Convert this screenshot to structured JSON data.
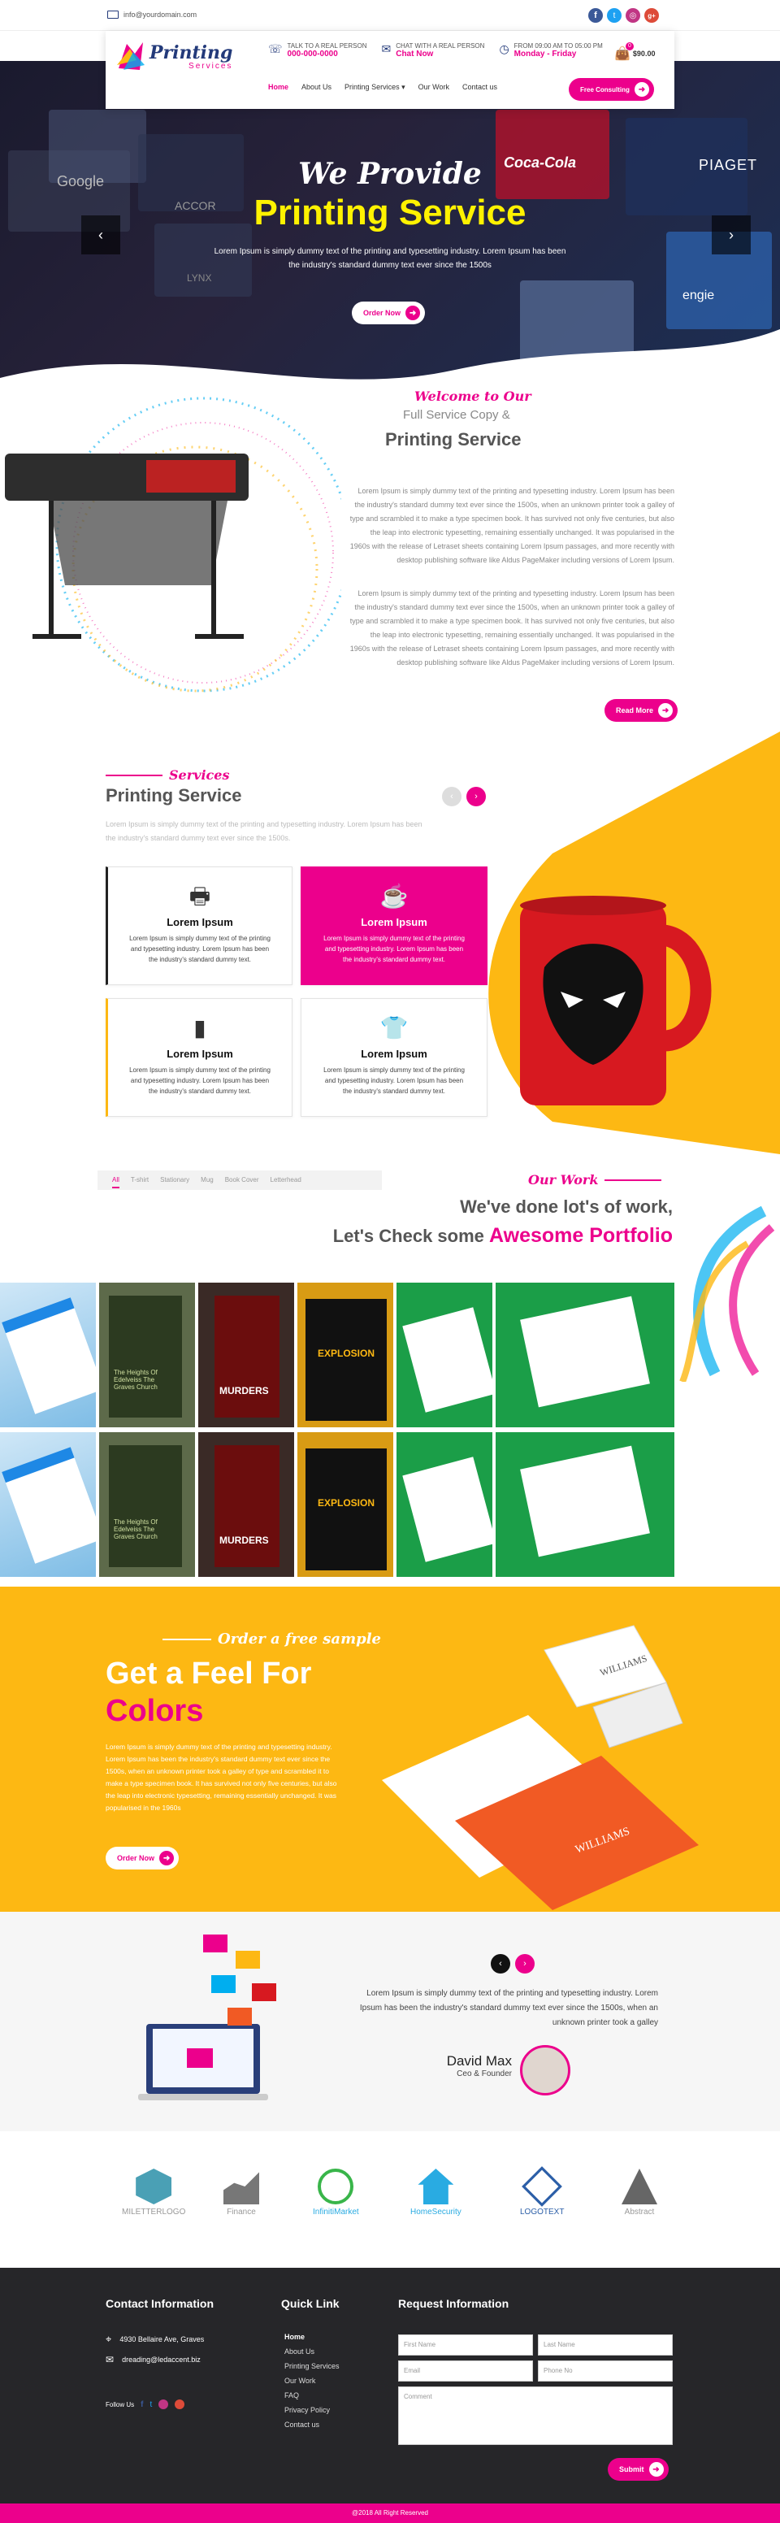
{
  "colors": {
    "pink": "#ec008c",
    "yellow": "#fdb813",
    "dark": "#262629",
    "navy": "#233a7a"
  },
  "topbar": {
    "email": "info@yourdomain.com",
    "socials": [
      "facebook-icon",
      "twitter-icon",
      "instagram-icon",
      "google-plus-icon"
    ]
  },
  "brand": {
    "name": "Printing",
    "sub": "Services"
  },
  "contact": [
    {
      "label": "TALK TO A REAL PERSON",
      "value": "000-000-0000"
    },
    {
      "label": "CHAT WITH A REAL PERSON",
      "value": "Chat Now"
    },
    {
      "label": "FROM 09:00 AM TO 05:00 PM",
      "value": "Monday - Friday"
    }
  ],
  "cart": {
    "price": "$90.00",
    "count": "0"
  },
  "nav": {
    "items": [
      "Home",
      "About Us",
      "Printing Services",
      "Our Work",
      "Contact us"
    ],
    "cta": "Free Consulting"
  },
  "hero": {
    "line1": "We Provide",
    "line2": "Printing Service",
    "text": "Lorem Ipsum is simply dummy text of the printing and typesetting industry. Lorem Ipsum has been the industry's standard dummy text ever since the 1500s",
    "btn": "Order Now",
    "tiles": [
      "Coca-Cola",
      "Google",
      "ACCOR",
      "PIAGET",
      "engie",
      "LYNX"
    ]
  },
  "about": {
    "script": "Welcome to Our",
    "sub": "Full Service Copy &",
    "title": "Printing Service",
    "p1": "Lorem Ipsum is simply dummy text of the printing and typesetting industry. Lorem Ipsum has been the industry's standard dummy text ever since the 1500s, when an unknown printer took a galley of type and scrambled it to make a type specimen book. It has survived not only five centuries, but also the leap into electronic typesetting, remaining essentially unchanged. It was popularised in the 1960s with the release of Letraset sheets containing Lorem Ipsum passages, and more recently with desktop publishing software like Aldus PageMaker including versions of Lorem Ipsum.",
    "p2": "Lorem Ipsum is simply dummy text of the printing and typesetting industry. Lorem Ipsum has been the industry's standard dummy text ever since the 1500s, when an unknown printer took a galley of type and scrambled it to make a type specimen book. It has survived not only five centuries, but also the leap into electronic typesetting, remaining essentially unchanged. It was popularised in the 1960s with the release of Letraset sheets containing Lorem Ipsum passages, and more recently with desktop publishing software like Aldus PageMaker including versions of Lorem Ipsum.",
    "btn": "Read More"
  },
  "services": {
    "script": "Services",
    "title": "Printing Service",
    "text": "Lorem Ipsum is simply dummy text of the printing and typesetting industry. Lorem Ipsum has been the industry's standard dummy text ever since the 1500s.",
    "cards": [
      {
        "title": "Lorem Ipsum",
        "text": "Lorem Ipsum is simply dummy text of the printing and typesetting industry. Lorem Ipsum has been the industry's standard dummy text.",
        "icon": "printer-icon"
      },
      {
        "title": "Lorem Ipsum",
        "text": "Lorem Ipsum is simply dummy text of the printing and typesetting industry. Lorem Ipsum has been the industry's standard dummy text.",
        "icon": "mug-icon"
      },
      {
        "title": "Lorem Ipsum",
        "text": "Lorem Ipsum is simply dummy text of the printing and typesetting industry. Lorem Ipsum has been the industry's standard dummy text.",
        "icon": "stationery-icon"
      },
      {
        "title": "Lorem Ipsum",
        "text": "Lorem Ipsum is simply dummy text of the printing and typesetting industry. Lorem Ipsum has been the industry's standard dummy text.",
        "icon": "tshirt-icon"
      }
    ]
  },
  "work": {
    "filters": [
      "All",
      "T-shirt",
      "Stationary",
      "Mug",
      "Book Cover",
      "Letterhead"
    ],
    "script": "Our Work",
    "line1": "We've done lot's of work,",
    "line2a": "Let's Check some",
    "line2b": "Awesome Portfolio",
    "items": [
      {
        "caption": ""
      },
      {
        "caption": "The Heights Of Edelveiss The Graves Church"
      },
      {
        "caption": "MURDERS"
      },
      {
        "caption": "EXPLOSION"
      },
      {
        "caption": ""
      }
    ]
  },
  "sample": {
    "script": "Order a free sample",
    "line1": "Get a Feel For",
    "line2": "Colors",
    "text": "Lorem Ipsum is simply dummy text of the printing and typesetting industry. Lorem Ipsum has been the industry's standard dummy text ever since the 1500s, when an unknown printer took a galley of type and scrambled it to make a type specimen book. It has survived not only five centuries, but also the leap into electronic typesetting, remaining essentially unchanged. It was popularised in the 1960s",
    "btn": "Order Now",
    "brand": "WILLIAMS"
  },
  "testimonial": {
    "text": "Lorem Ipsum is simply dummy text of the printing and typesetting industry. Lorem Ipsum has been the industry's standard dummy text ever since the 1500s, when an unknown printer took a galley",
    "name": "David Max",
    "role": "Ceo & Founder"
  },
  "clients": [
    "MILETTERLOGO",
    "Finance",
    "InfinitiMarket",
    "HomeSecurity",
    "LOGOTEXT",
    "Abstract"
  ],
  "footer": {
    "contact_title": "Contact Information",
    "address": "4930 Bellaire Ave, Graves",
    "email": "dreading@ledaccent.biz",
    "follow": "Follow Us",
    "links_title": "Quick Link",
    "links": [
      "Home",
      "About Us",
      "Printing Services",
      "Our Work",
      "FAQ",
      "Privacy Policy",
      "Contact us"
    ],
    "req_title": "Request Information",
    "fields": {
      "first": "First Name",
      "last": "Last Name",
      "email": "Email",
      "phone": "Phone No",
      "comment": "Comment"
    },
    "submit": "Submit",
    "copy": "@2018 All Right Reserved"
  }
}
